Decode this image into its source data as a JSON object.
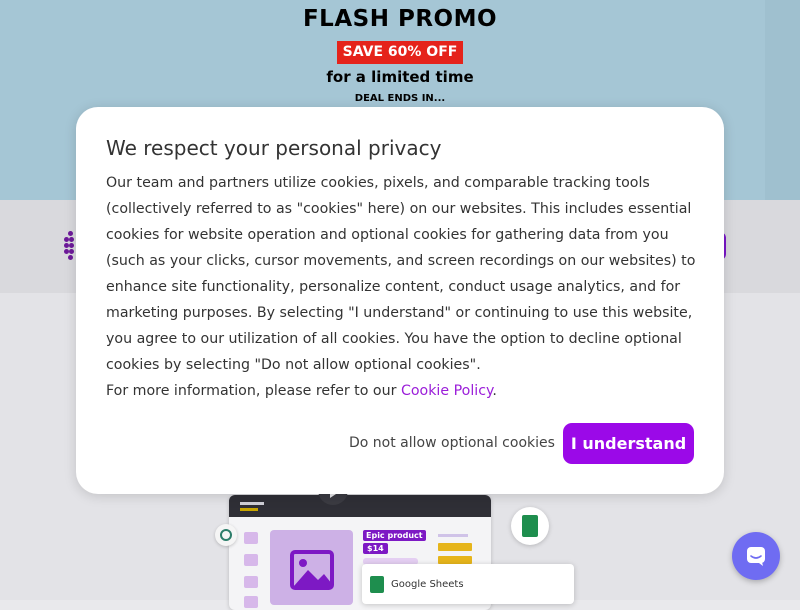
{
  "promo": {
    "title": "FLASH PROMO",
    "badge": "SAVE 60% OFF",
    "subtitle": "for a limited time",
    "deal_text": "DEAL ENDS IN..."
  },
  "modal": {
    "title": "We respect your personal privacy",
    "body": "Our team and partners utilize cookies, pixels, and comparable tracking tools (collectively referred to as \"cookies\" here) on our websites. This includes essential cookies for website operation and optional cookies for gathering data from you (such as your clicks, cursor movements, and screen recordings on our websites) to enhance site functionality, personalize content, conduct usage analytics, and for marketing purposes. By selecting \"I understand\" or continuing to use this website, you agree to our utilization of all cookies. You have the option to decline optional cookies by selecting \"Do not allow optional cookies\".",
    "more_info_prefix": "For more information, please refer to our ",
    "link_label": "Cookie Policy",
    "more_info_suffix": ".",
    "decline_label": "Do not allow optional cookies",
    "accept_label": "I understand"
  },
  "preview": {
    "tag_label": "Epic product",
    "price_label": "$14",
    "integration_label": "Google Sheets"
  },
  "colors": {
    "accent": "#9b09e8",
    "promo_background": "#a5c6d5",
    "badge_red": "#e5231b",
    "chat_button": "#6f6cf2",
    "link": "#9b1ed9"
  },
  "icons": {
    "logo": "dots-logo-icon",
    "play": "play-icon",
    "image": "image-placeholder-icon",
    "google_sheets": "google-sheets-icon",
    "chatgpt": "chatgpt-icon",
    "chat": "chat-bubble-icon"
  }
}
